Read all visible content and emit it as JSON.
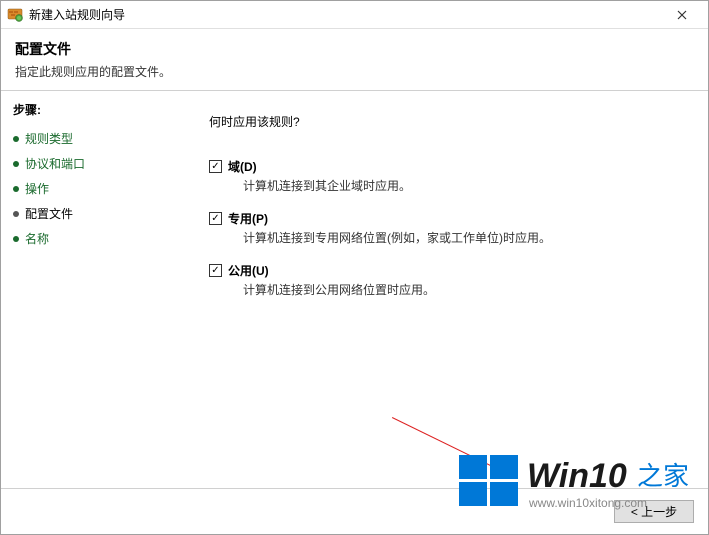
{
  "titlebar": {
    "title": "新建入站规则向导"
  },
  "header": {
    "title": "配置文件",
    "description": "指定此规则应用的配置文件。"
  },
  "sidebar": {
    "steps_label": "步骤:",
    "items": [
      {
        "label": "规则类型"
      },
      {
        "label": "协议和端口"
      },
      {
        "label": "操作"
      },
      {
        "label": "配置文件"
      },
      {
        "label": "名称"
      }
    ]
  },
  "content": {
    "question": "何时应用该规则?",
    "options": [
      {
        "label": "域(D)",
        "description": "计算机连接到其企业域时应用。",
        "checked": true
      },
      {
        "label": "专用(P)",
        "description": "计算机连接到专用网络位置(例如，家或工作单位)时应用。",
        "checked": true
      },
      {
        "label": "公用(U)",
        "description": "计算机连接到公用网络位置时应用。",
        "checked": true
      }
    ]
  },
  "footer": {
    "back": "< 上一步"
  },
  "watermark": {
    "brand": "Win10",
    "suffix": "之家",
    "url": "www.win10xitong.com"
  }
}
